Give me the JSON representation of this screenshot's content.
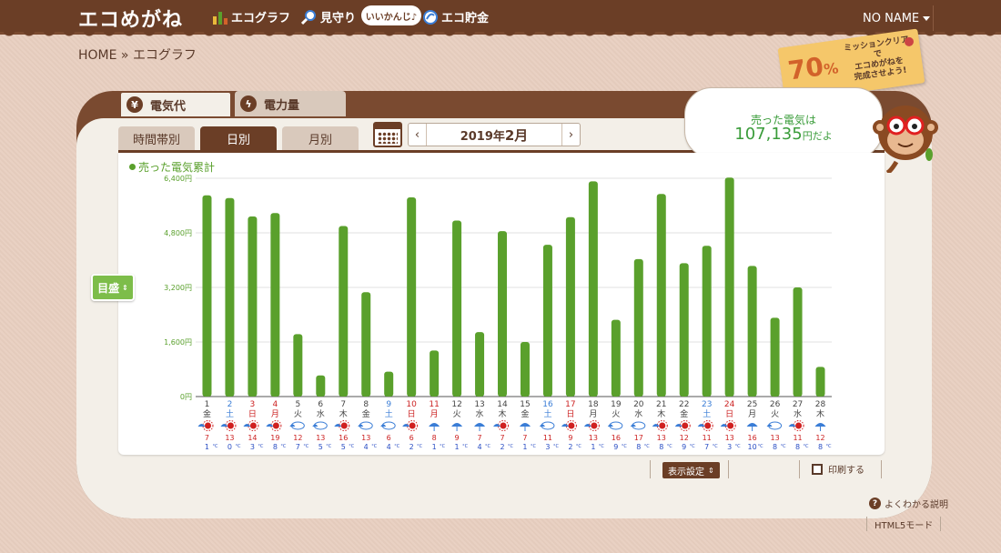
{
  "header": {
    "logo": "エコめがね",
    "nav": [
      {
        "label": "エコグラフ",
        "icon": "bar-graph-icon"
      },
      {
        "label": "見守り",
        "icon": "magnifier-icon"
      },
      {
        "label": "エコ貯金",
        "icon": "coin-icon"
      }
    ],
    "badge": "いいかんじ♪",
    "user": "NO NAME"
  },
  "breadcrumb": "HOME » エコグラフ",
  "mission": {
    "percent": "70",
    "unit": "%",
    "text_lines": [
      "ミッションクリアで",
      "エコめがねを",
      "完成させよう!"
    ]
  },
  "tabs": {
    "top": [
      "電気代",
      "電力量"
    ],
    "sub": [
      "時間帯別",
      "日別",
      "月別"
    ]
  },
  "month": {
    "year_prefix": "2019年",
    "month": "2月"
  },
  "bubble": {
    "label": "売った電気は",
    "value": "107,135",
    "unit": "円だよ"
  },
  "meter_toggle": "目盛",
  "controls": {
    "display_settings": "表示設定",
    "print": "印刷する",
    "help": "よくわかる説明",
    "html5": "HTML5モード"
  },
  "colors": {
    "brown": "#6b3e26",
    "bar_green": "#5aa02c",
    "bubble_green": "#3a9c3a",
    "sat": "#3a7dd6",
    "sun": "#cc2222"
  },
  "chart_data": {
    "type": "bar",
    "title": "売った電気累計",
    "ylim": [
      0,
      6400
    ],
    "yticks": [
      "0円",
      "1,600円",
      "3,200円",
      "4,800円",
      "6,400円"
    ],
    "days": [
      "1",
      "2",
      "3",
      "4",
      "5",
      "6",
      "7",
      "8",
      "9",
      "10",
      "11",
      "12",
      "13",
      "14",
      "15",
      "16",
      "17",
      "18",
      "19",
      "20",
      "21",
      "22",
      "23",
      "24",
      "25",
      "26",
      "27",
      "28"
    ],
    "weekdays": [
      "金",
      "土",
      "日",
      "月",
      "火",
      "水",
      "木",
      "金",
      "土",
      "日",
      "月",
      "火",
      "水",
      "木",
      "金",
      "土",
      "日",
      "月",
      "火",
      "水",
      "木",
      "金",
      "土",
      "日",
      "月",
      "火",
      "水",
      "木"
    ],
    "day_types": [
      "wk",
      "sat",
      "sun",
      "hol",
      "wk",
      "wk",
      "wk",
      "wk",
      "sat",
      "sun",
      "hol",
      "wk",
      "wk",
      "wk",
      "wk",
      "sat",
      "sun",
      "wk",
      "wk",
      "wk",
      "wk",
      "wk",
      "sat",
      "sun",
      "wk",
      "wk",
      "wk",
      "wk"
    ],
    "values": [
      5900,
      5820,
      5280,
      5380,
      1830,
      620,
      5000,
      3060,
      730,
      5840,
      1350,
      5160,
      1890,
      4850,
      1600,
      4450,
      5260,
      6310,
      2250,
      4030,
      5940,
      3910,
      4420,
      6420,
      3830,
      2310,
      3200,
      870
    ],
    "weather": [
      "sun",
      "sun",
      "sun",
      "sun",
      "cloud",
      "cloud",
      "sun",
      "cloud",
      "cloud",
      "sun",
      "rain",
      "rain",
      "rain",
      "sun",
      "rain",
      "cloud",
      "sun",
      "sun",
      "cloud",
      "cloud",
      "sun",
      "sun",
      "sun",
      "sun",
      "rain",
      "cloud",
      "sun",
      "rain"
    ],
    "temp_high": [
      7,
      13,
      14,
      19,
      12,
      13,
      16,
      13,
      6,
      6,
      8,
      9,
      7,
      7,
      7,
      11,
      9,
      13,
      16,
      17,
      13,
      12,
      11,
      13,
      16,
      13,
      11,
      12
    ],
    "temp_low": [
      1,
      0,
      3,
      8,
      7,
      5,
      5,
      4,
      4,
      2,
      1,
      1,
      4,
      2,
      1,
      3,
      2,
      1,
      9,
      8,
      8,
      9,
      7,
      3,
      10,
      8,
      8,
      8
    ]
  }
}
